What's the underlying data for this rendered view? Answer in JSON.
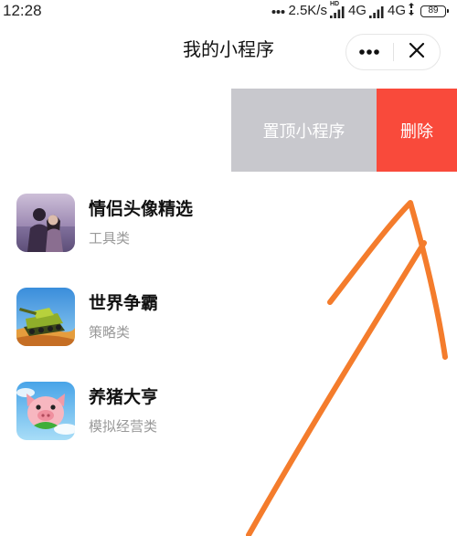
{
  "status_bar": {
    "time": "12:28",
    "network_speed": "2.5K/s",
    "hd_label": "HD",
    "network_type_1": "4G",
    "network_type_2": "4G",
    "battery_level": "89"
  },
  "header": {
    "title": "我的小程序",
    "more_icon": "more-dots-icon",
    "close_icon": "close-icon"
  },
  "swiped_item": {
    "actions": [
      {
        "label": "置顶小程序",
        "color": "#c8c8cd"
      },
      {
        "label": "删除",
        "color": "#f94a3b"
      }
    ]
  },
  "apps": [
    {
      "name": "情侣头像精选",
      "category": "工具类",
      "icon": "couple-photo-icon"
    },
    {
      "name": "世界争霸",
      "category": "策略类",
      "icon": "tank-game-icon"
    },
    {
      "name": "养猪大亨",
      "category": "模拟经营类",
      "icon": "pig-game-icon"
    }
  ],
  "annotation_arrow": {
    "color": "#f47c2c"
  }
}
